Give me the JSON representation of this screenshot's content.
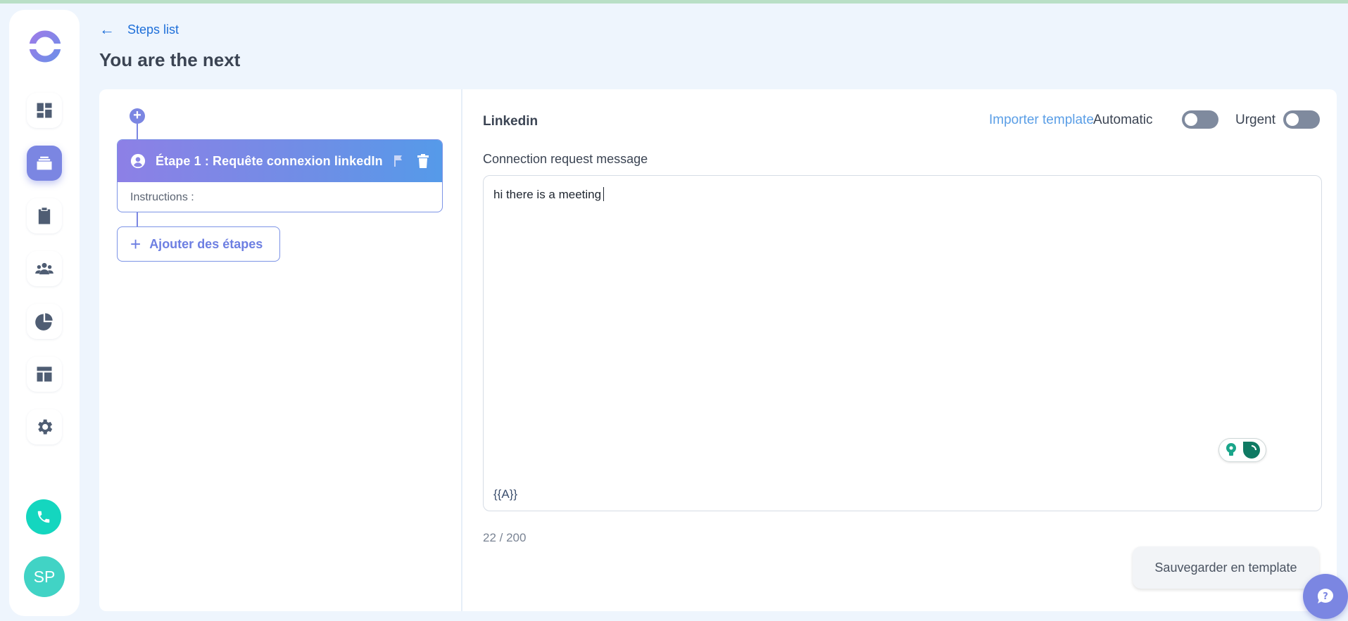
{
  "header": {
    "back_label": "Steps list",
    "page_title": "You are the next"
  },
  "sidebar": {
    "items": [
      {
        "name": "dashboard-icon",
        "active": false
      },
      {
        "name": "campaigns-icon",
        "active": true
      },
      {
        "name": "tasks-icon",
        "active": false
      },
      {
        "name": "contacts-icon",
        "active": false
      },
      {
        "name": "analytics-icon",
        "active": false
      },
      {
        "name": "templates-icon",
        "active": false
      },
      {
        "name": "settings-icon",
        "active": false
      }
    ],
    "avatar_initials": "SP"
  },
  "steps": {
    "items": [
      {
        "title": "Étape 1 : Requête connexion linkedIn",
        "instructions_label": "Instructions :"
      }
    ],
    "add_steps_label": "Ajouter des étapes"
  },
  "editor": {
    "channel": "Linkedin",
    "import_template_label": "Importer template",
    "automatic_label": "Automatic",
    "automatic_on": false,
    "urgent_label": "Urgent",
    "urgent_on": false,
    "field_label": "Connection request message",
    "message_value": "hi there is a meeting",
    "variable_tag": "{{A}}",
    "char_count": "22 / 200",
    "save_template_label": "Sauvegarder en template"
  },
  "colors": {
    "accent": "#7b86e2",
    "link": "#1e6fd9",
    "phone": "#14d6bf",
    "avatar": "#41d3c5",
    "page_bg": "#eef5fd"
  }
}
